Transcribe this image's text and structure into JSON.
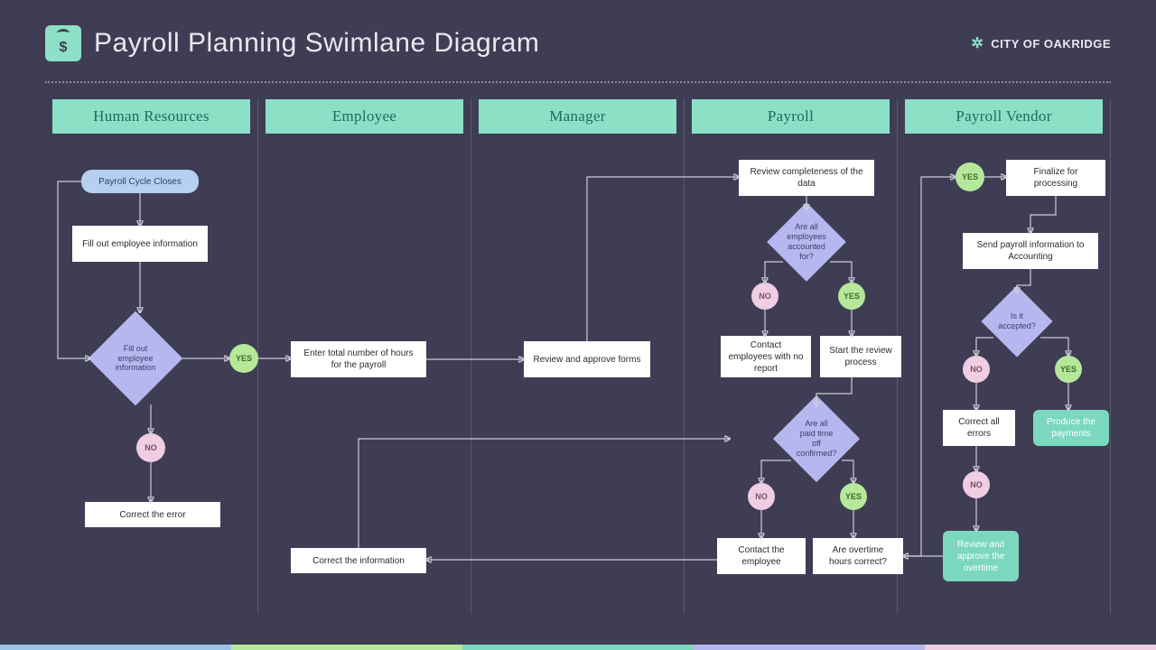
{
  "header": {
    "title": "Payroll Planning Swimlane Diagram",
    "org": "CITY OF OAKRIDGE"
  },
  "lanes": [
    "Human Resources",
    "Employee",
    "Manager",
    "Payroll",
    "Payroll Vendor"
  ],
  "nodes": {
    "hr_start": "Payroll Cycle Closes",
    "hr_fillinfo": "Fill out employee information",
    "hr_decide": "Fill out employee information",
    "hr_correct": "Correct the error",
    "emp_hours": "Enter total number of hours for the payroll",
    "emp_correctinfo": "Correct the information",
    "mgr_review": "Review and approve forms",
    "pay_reviewdata": "Review completeness of the data",
    "pay_q1": "Are all employees accounted for?",
    "pay_contact1": "Contact employees with no report",
    "pay_startreview": "Start the review process",
    "pay_q2": "Are all paid time off confirmed?",
    "pay_contact2": "Contact the employee",
    "pay_overtime": "Are overtime hours correct?",
    "ven_finalize": "Finalize for processing",
    "ven_send": "Send payroll information to Accounting",
    "ven_q": "Is it accepted?",
    "ven_correct": "Correct all errors",
    "ven_produce": "Produce the payments",
    "ven_reviewot": "Review  and approve the overtime"
  },
  "labels": {
    "yes": "YES",
    "no": "NO"
  },
  "footer_colors": [
    "#9bc4e4",
    "#b6e89a",
    "#7bd8bc",
    "#b7b7f0",
    "#f0cde2"
  ]
}
